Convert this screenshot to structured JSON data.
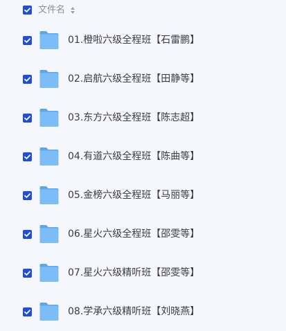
{
  "header": {
    "column_label": "文件名",
    "select_all_checked": true,
    "sort_icon": "sort-icon"
  },
  "files": [
    {
      "name": "01.橙啦六级全程班【石雷鹏】",
      "checked": true,
      "icon": "folder-icon"
    },
    {
      "name": "02.启航六级全程班【田静等】",
      "checked": true,
      "icon": "folder-icon"
    },
    {
      "name": "03.东方六级全程班【陈志超】",
      "checked": true,
      "icon": "folder-icon"
    },
    {
      "name": "04.有道六级全程班【陈曲等】",
      "checked": true,
      "icon": "folder-icon"
    },
    {
      "name": "05.金榜六级全程班【马丽等】",
      "checked": true,
      "icon": "folder-icon"
    },
    {
      "name": "06.星火六级全程班【邵雯等】",
      "checked": true,
      "icon": "folder-icon"
    },
    {
      "name": "07.星火六级精听班【邵雯等】",
      "checked": true,
      "icon": "folder-icon"
    },
    {
      "name": "08.学承六级精听班【刘晓燕】",
      "checked": true,
      "icon": "folder-icon"
    }
  ],
  "colors": {
    "checkbox": "#1f4fd6",
    "folder": "#6fb3f5",
    "background": "#f6f7fc"
  }
}
